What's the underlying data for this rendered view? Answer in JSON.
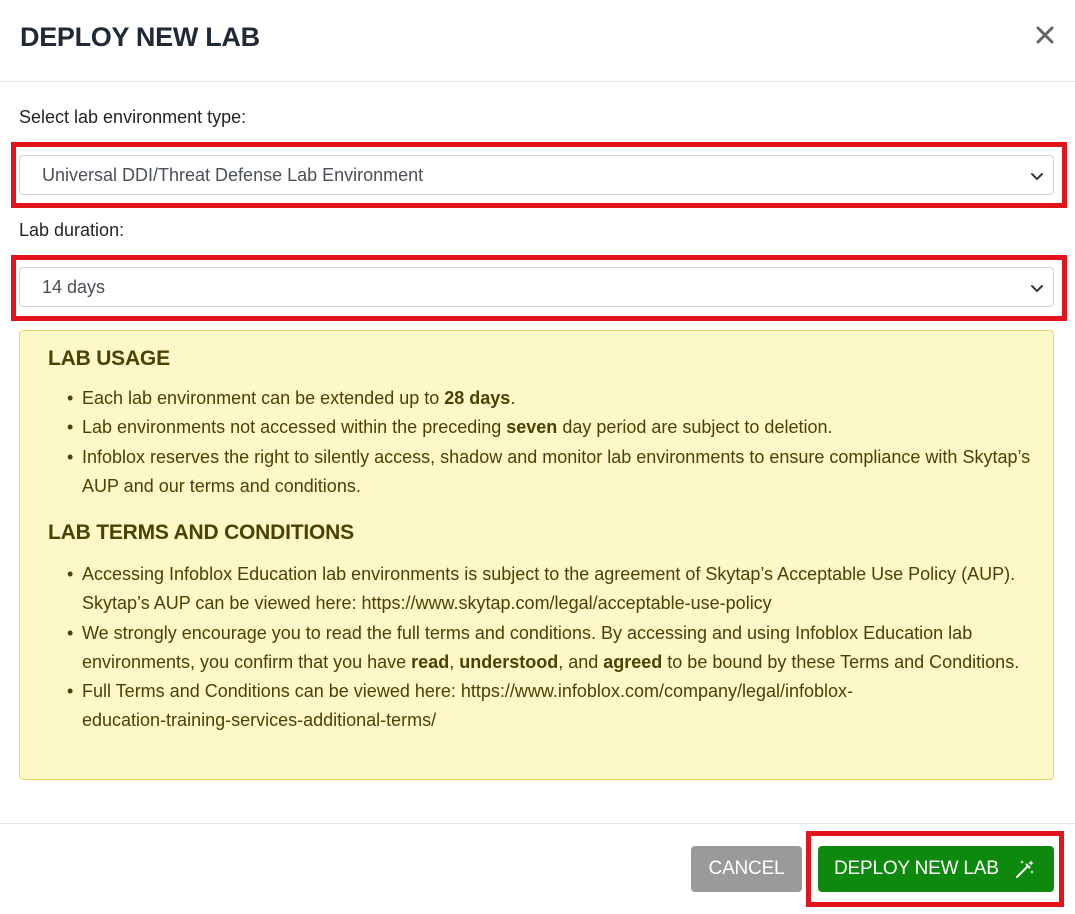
{
  "modal": {
    "title": "DEPLOY NEW LAB"
  },
  "form": {
    "env_label": "Select lab environment type:",
    "env_selected": "Universal DDI/Threat Defense Lab Environment",
    "duration_label": "Lab duration:",
    "duration_selected": "14 days"
  },
  "notice": {
    "usage_heading": "LAB USAGE",
    "usage_items": [
      {
        "pre": "Each lab environment can be extended up to ",
        "bold": "28 days",
        "post": "."
      },
      {
        "pre": "Lab environments not accessed within the preceding ",
        "bold": "seven",
        "post": " day period are subject to deletion."
      },
      {
        "text": "Infoblox reserves the right to silently access, shadow and monitor lab environments to ensure compliance with Skytap’s AUP and our terms and conditions."
      }
    ],
    "terms_heading": "LAB TERMS AND CONDITIONS",
    "terms_items": [
      {
        "text": "Accessing Infoblox Education lab environments is subject to the agreement of Skytap’s Acceptable Use Policy (AUP). Skytap’s AUP can be viewed here: https://www.skytap.com/legal/acceptable-use-policy"
      },
      {
        "p1": "We strongly encourage you to read the full terms and conditions. By accessing and using Infoblox Education lab environments, you confirm that you have ",
        "b1": "read",
        "p2": ", ",
        "b2": "understood",
        "p3": ", and ",
        "b3": "agreed",
        "p4": " to be bound by these Terms and Conditions."
      },
      {
        "line1": "Full Terms and Conditions can be viewed here: https://www.infoblox.com/company/legal/infoblox-",
        "line2": "education-training-services-additional-terms/"
      }
    ]
  },
  "footer": {
    "cancel_label": "CANCEL",
    "deploy_label": "DEPLOY NEW LAB"
  },
  "icons": {
    "close": "close-icon",
    "chevron": "chevron-down-icon",
    "deploy": "magic-wand-icon"
  },
  "colors": {
    "highlight": "#e3141b",
    "deploy_button": "#0d8a0d",
    "cancel_button": "#9a9a9a",
    "notice_background": "#fdf8c8",
    "notice_text": "#4a4200"
  }
}
